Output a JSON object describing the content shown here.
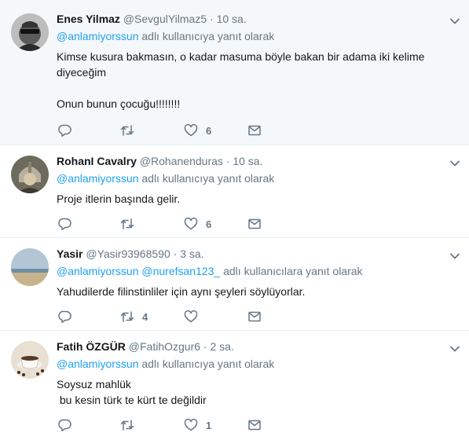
{
  "tweets": [
    {
      "fullname": "Enes Yilmaz",
      "handle": "@SevgulYilmaz5",
      "dot": "·",
      "time": "10 sa.",
      "reply_mentions": [
        "@anlamiyorssun"
      ],
      "reply_suffix": "adlı kullanıcıya yanıt olarak",
      "text": "Kimse kusura bakmasın, o kadar masuma böyle bakan bir adama iki kelime diyeceğim\n\nOnun bunun çocuğu!!!!!!!!",
      "retweets": "",
      "likes": "6"
    },
    {
      "fullname": "RohanI Cavalry",
      "handle": "@Rohanenduras",
      "dot": "·",
      "time": "10 sa.",
      "reply_mentions": [
        "@anlamiyorssun"
      ],
      "reply_suffix": "adlı kullanıcıya yanıt olarak",
      "text": "Proje itlerin başında gelir.",
      "retweets": "",
      "likes": "6"
    },
    {
      "fullname": "Yasir",
      "handle": "@Yasir93968590",
      "dot": "·",
      "time": "3 sa.",
      "reply_mentions": [
        "@anlamiyorssun",
        "@nurefsan123_"
      ],
      "reply_suffix": "adlı kullanıcılara yanıt olarak",
      "text": "Yahudilerde filinstinliler için aynı şeyleri söylüyorlar.",
      "retweets": "4",
      "likes": ""
    },
    {
      "fullname": "Fatih ÖZGÜR",
      "handle": "@FatihOzgur6",
      "dot": "·",
      "time": "2 sa.",
      "reply_mentions": [
        "@anlamiyorssun"
      ],
      "reply_suffix": "adlı kullanıcıya yanıt olarak",
      "text": "Soysuz mahlük\n bu kesin türk te kürt te değildir",
      "retweets": "",
      "likes": "1"
    }
  ],
  "colors": {
    "name": "#14171a",
    "secondary": "#657786",
    "link": "#1da1f2",
    "highlight_bg": "#f5f8fa",
    "divider": "#e6ecf0"
  },
  "icons": [
    "reply-icon",
    "retweet-icon",
    "like-icon",
    "direct-message-icon",
    "chevron-down-icon"
  ]
}
